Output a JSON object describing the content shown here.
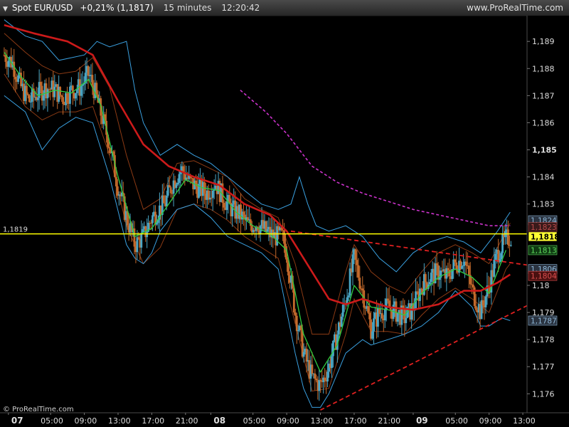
{
  "header": {
    "instrument": "Spot EUR/USD",
    "change": "+0,21% (1,1817)",
    "timeframe": "15 minutes",
    "time": "12:20:42",
    "website": "www.ProRealTime.com"
  },
  "copyright": "© ProRealTime.com",
  "colors": {
    "background": "#000000",
    "up_candle": "#4aa7c6",
    "down_candle": "#c46a2c",
    "ma_green": "#2ecc40",
    "ma_red": "#cc1a1a",
    "bollinger": "#3aa0e0",
    "envelope": "#8b3a14",
    "ma_dashed_magenta": "#cc33cc",
    "trendline_red": "#e02020",
    "price_line": "#ffff00"
  },
  "chart_data": {
    "type": "candlestick",
    "instrument": "Spot EUR/USD",
    "timeframe": "15 minutes",
    "ylim": [
      1.1753,
      1.18995
    ],
    "y_ticks": [
      "1,189",
      "1,188",
      "1,187",
      "1,186",
      "1,185",
      "1,184",
      "1,183",
      "1,18",
      "1,179",
      "1,178",
      "1,177",
      "1,176"
    ],
    "y_tick_values": [
      1.189,
      1.188,
      1.187,
      1.186,
      1.185,
      1.184,
      1.183,
      1.18,
      1.179,
      1.178,
      1.177,
      1.176
    ],
    "x_labels": [
      {
        "label": "07",
        "x": 0,
        "bold": true
      },
      {
        "label": "05:00",
        "x": 5,
        "bold": false
      },
      {
        "label": "09:00",
        "x": 9,
        "bold": false
      },
      {
        "label": "13:00",
        "x": 13,
        "bold": false
      },
      {
        "label": "17:00",
        "x": 17,
        "bold": false
      },
      {
        "label": "21:00",
        "x": 21,
        "bold": false
      },
      {
        "label": "08",
        "x": 24,
        "bold": true
      },
      {
        "label": "05:00",
        "x": 29,
        "bold": false
      },
      {
        "label": "09:00",
        "x": 33,
        "bold": false
      },
      {
        "label": "13:00",
        "x": 37,
        "bold": false
      },
      {
        "label": "17:00",
        "x": 41,
        "bold": false
      },
      {
        "label": "21:00",
        "x": 45,
        "bold": false
      },
      {
        "label": "09",
        "x": 48,
        "bold": true
      },
      {
        "label": "05:00",
        "x": 53,
        "bold": false
      },
      {
        "label": "09:00",
        "x": 57,
        "bold": false
      },
      {
        "label": "13:00",
        "x": 61,
        "bold": false
      }
    ],
    "x_range": [
      -1,
      61.5
    ],
    "price_line": {
      "value": 1.1819,
      "label": "1,1819"
    },
    "right_price_labels": [
      {
        "text": "1,1824",
        "value": 1.1824,
        "bg": "#2a3340",
        "color": "#8fb8d8"
      },
      {
        "text": "1,1823",
        "value": 1.18215,
        "bg": "#3a1a1a",
        "color": "#b84a4a"
      },
      {
        "text": "1,1818",
        "value": 1.1818,
        "bg": "#ffff33",
        "color": "#000000"
      },
      {
        "text": "1,1813",
        "value": 1.1813,
        "bg": "#0f3a12",
        "color": "#5fdc5f"
      },
      {
        "text": "1,1806",
        "value": 1.1806,
        "bg": "#2a3340",
        "color": "#8fb8d8"
      },
      {
        "text": "1,1804",
        "value": 1.18035,
        "bg": "#4a1010",
        "color": "#e05050"
      },
      {
        "text": "1,1787",
        "value": 1.1787,
        "bg": "#2a3340",
        "color": "#8fb8d8"
      }
    ],
    "close_path": [
      [
        -0.5,
        1.1885
      ],
      [
        0.5,
        1.1882
      ],
      [
        1.5,
        1.1873
      ],
      [
        2.5,
        1.1868
      ],
      [
        3.5,
        1.1871
      ],
      [
        4.5,
        1.1873
      ],
      [
        5.5,
        1.1872
      ],
      [
        6.5,
        1.1869
      ],
      [
        7.5,
        1.1872
      ],
      [
        8.5,
        1.1873
      ],
      [
        9.5,
        1.1878
      ],
      [
        10.0,
        1.1874
      ],
      [
        11.0,
        1.1863
      ],
      [
        12.0,
        1.1852
      ],
      [
        13.0,
        1.1836
      ],
      [
        14.0,
        1.1825
      ],
      [
        15.0,
        1.1815
      ],
      [
        16.0,
        1.1818
      ],
      [
        17.0,
        1.1825
      ],
      [
        18.5,
        1.183
      ],
      [
        19.5,
        1.1838
      ],
      [
        20.5,
        1.1843
      ],
      [
        21.5,
        1.1838
      ],
      [
        22.5,
        1.1836
      ],
      [
        23.5,
        1.1834
      ],
      [
        24.5,
        1.1838
      ],
      [
        25.5,
        1.1832
      ],
      [
        26.5,
        1.1828
      ],
      [
        27.5,
        1.1826
      ],
      [
        28.5,
        1.1822
      ],
      [
        29.5,
        1.1823
      ],
      [
        30.5,
        1.182
      ],
      [
        31.5,
        1.1818
      ],
      [
        32.5,
        1.1818
      ],
      [
        33.0,
        1.1812
      ],
      [
        34.0,
        1.179
      ],
      [
        35.0,
        1.1775
      ],
      [
        36.0,
        1.1766
      ],
      [
        37.0,
        1.1763
      ],
      [
        38.0,
        1.177
      ],
      [
        39.0,
        1.1782
      ],
      [
        40.0,
        1.1795
      ],
      [
        41.0,
        1.181
      ],
      [
        42.0,
        1.1798
      ],
      [
        43.0,
        1.1784
      ],
      [
        44.0,
        1.179
      ],
      [
        45.0,
        1.1792
      ],
      [
        46.0,
        1.179
      ],
      [
        47.0,
        1.1788
      ],
      [
        48.0,
        1.1792
      ],
      [
        49.0,
        1.18
      ],
      [
        50.0,
        1.1803
      ],
      [
        51.0,
        1.1805
      ],
      [
        52.0,
        1.1803
      ],
      [
        53.0,
        1.1808
      ],
      [
        54.0,
        1.181
      ],
      [
        55.0,
        1.1798
      ],
      [
        56.0,
        1.179
      ],
      [
        57.0,
        1.18
      ],
      [
        58.0,
        1.1812
      ],
      [
        59.0,
        1.1817
      ],
      [
        59.6,
        1.1818
      ]
    ],
    "moving_averages": [
      {
        "style": "solid",
        "color": "#2ecc40",
        "width": 1.3,
        "points": [
          [
            -0.5,
            1.1886
          ],
          [
            1.5,
            1.1877
          ],
          [
            3.5,
            1.187
          ],
          [
            5.5,
            1.1872
          ],
          [
            7.5,
            1.1871
          ],
          [
            9.5,
            1.1876
          ],
          [
            11.0,
            1.1866
          ],
          [
            13.0,
            1.184
          ],
          [
            15.0,
            1.1818
          ],
          [
            17.0,
            1.1821
          ],
          [
            19.0,
            1.183
          ],
          [
            21.0,
            1.1839
          ],
          [
            23.0,
            1.1836
          ],
          [
            25.0,
            1.1835
          ],
          [
            27.0,
            1.1827
          ],
          [
            29.0,
            1.1822
          ],
          [
            31.0,
            1.1819
          ],
          [
            33.0,
            1.1813
          ],
          [
            35.0,
            1.1782
          ],
          [
            37.0,
            1.1768
          ],
          [
            39.0,
            1.1778
          ],
          [
            41.0,
            1.18
          ],
          [
            43.0,
            1.1792
          ],
          [
            45.0,
            1.1791
          ],
          [
            47.0,
            1.1789
          ],
          [
            49.0,
            1.1797
          ],
          [
            51.0,
            1.1803
          ],
          [
            53.0,
            1.1806
          ],
          [
            55.0,
            1.1803
          ],
          [
            57.0,
            1.1797
          ],
          [
            59.0,
            1.1813
          ]
        ]
      },
      {
        "style": "solid",
        "color": "#cc1a1a",
        "width": 2.6,
        "points": [
          [
            -0.5,
            1.1896
          ],
          [
            3.0,
            1.1893
          ],
          [
            7.0,
            1.189
          ],
          [
            10.0,
            1.1885
          ],
          [
            13.0,
            1.1868
          ],
          [
            16.0,
            1.1852
          ],
          [
            19.0,
            1.1844
          ],
          [
            22.0,
            1.184
          ],
          [
            25.0,
            1.1837
          ],
          [
            28.0,
            1.183
          ],
          [
            31.0,
            1.1826
          ],
          [
            33.0,
            1.182
          ],
          [
            36.0,
            1.1805
          ],
          [
            38.0,
            1.1795
          ],
          [
            40.0,
            1.1793
          ],
          [
            42.0,
            1.1795
          ],
          [
            45.0,
            1.1792
          ],
          [
            48.0,
            1.1791
          ],
          [
            51.0,
            1.1793
          ],
          [
            54.0,
            1.1798
          ],
          [
            56.0,
            1.1798
          ],
          [
            58.0,
            1.1801
          ],
          [
            59.5,
            1.1804
          ]
        ]
      },
      {
        "style": "dashed",
        "color": "#cc33cc",
        "width": 1.6,
        "points": [
          [
            27.5,
            1.1872
          ],
          [
            30.5,
            1.1864
          ],
          [
            33.0,
            1.1856
          ],
          [
            36.0,
            1.1844
          ],
          [
            39.0,
            1.1838
          ],
          [
            42.0,
            1.1834
          ],
          [
            45.0,
            1.1831
          ],
          [
            48.0,
            1.1828
          ],
          [
            51.0,
            1.1826
          ],
          [
            54.0,
            1.1824
          ],
          [
            57.0,
            1.1822
          ],
          [
            59.5,
            1.1822
          ]
        ]
      }
    ],
    "bands": [
      {
        "color": "#3aa0e0",
        "width": 1,
        "points": [
          [
            -0.5,
            1.1898
          ],
          [
            2.0,
            1.1892
          ],
          [
            4.0,
            1.189
          ],
          [
            6.0,
            1.1883
          ],
          [
            9.0,
            1.1885
          ],
          [
            10.5,
            1.189
          ],
          [
            12.0,
            1.1888
          ],
          [
            14.0,
            1.189
          ],
          [
            15.0,
            1.1872
          ],
          [
            16.0,
            1.186
          ],
          [
            18.0,
            1.1848
          ],
          [
            20.0,
            1.1852
          ],
          [
            22.0,
            1.1848
          ],
          [
            24.0,
            1.1845
          ],
          [
            26.0,
            1.184
          ],
          [
            28.0,
            1.1835
          ],
          [
            30.0,
            1.183
          ],
          [
            32.0,
            1.1828
          ],
          [
            33.5,
            1.183
          ],
          [
            34.5,
            1.184
          ],
          [
            35.5,
            1.183
          ],
          [
            36.5,
            1.1822
          ],
          [
            38.0,
            1.182
          ],
          [
            40.0,
            1.1822
          ],
          [
            42.0,
            1.1818
          ],
          [
            44.0,
            1.181
          ],
          [
            46.0,
            1.1805
          ],
          [
            48.0,
            1.1812
          ],
          [
            50.0,
            1.1816
          ],
          [
            52.0,
            1.1818
          ],
          [
            54.0,
            1.1816
          ],
          [
            56.0,
            1.1812
          ],
          [
            58.0,
            1.182
          ],
          [
            59.5,
            1.1827
          ]
        ]
      },
      {
        "color": "#3aa0e0",
        "width": 1,
        "points": [
          [
            -0.5,
            1.187
          ],
          [
            2.0,
            1.1864
          ],
          [
            4.0,
            1.185
          ],
          [
            6.0,
            1.1858
          ],
          [
            8.0,
            1.1862
          ],
          [
            10.0,
            1.186
          ],
          [
            12.0,
            1.184
          ],
          [
            14.0,
            1.1815
          ],
          [
            15.0,
            1.181
          ],
          [
            16.0,
            1.1808
          ],
          [
            17.0,
            1.1812
          ],
          [
            18.0,
            1.182
          ],
          [
            20.0,
            1.1828
          ],
          [
            22.0,
            1.183
          ],
          [
            24.0,
            1.1825
          ],
          [
            26.0,
            1.1818
          ],
          [
            28.0,
            1.1815
          ],
          [
            30.0,
            1.1812
          ],
          [
            32.0,
            1.1806
          ],
          [
            34.0,
            1.1775
          ],
          [
            35.0,
            1.1762
          ],
          [
            36.0,
            1.1755
          ],
          [
            37.0,
            1.1755
          ],
          [
            38.0,
            1.176
          ],
          [
            40.0,
            1.1775
          ],
          [
            42.0,
            1.178
          ],
          [
            43.0,
            1.1778
          ],
          [
            45.0,
            1.178
          ],
          [
            47.0,
            1.1782
          ],
          [
            49.0,
            1.1785
          ],
          [
            51.0,
            1.179
          ],
          [
            53.0,
            1.1798
          ],
          [
            55.0,
            1.1792
          ],
          [
            56.0,
            1.1785
          ],
          [
            57.0,
            1.1785
          ],
          [
            58.5,
            1.1788
          ],
          [
            59.5,
            1.1787
          ]
        ]
      }
    ],
    "envelopes": [
      {
        "color": "#8b3a14",
        "width": 1,
        "points": [
          [
            -0.5,
            1.1893
          ],
          [
            2.0,
            1.1886
          ],
          [
            4.0,
            1.1881
          ],
          [
            6.0,
            1.1878
          ],
          [
            8.0,
            1.1879
          ],
          [
            10.0,
            1.1884
          ],
          [
            12.0,
            1.1873
          ],
          [
            14.0,
            1.1848
          ],
          [
            16.0,
            1.1828
          ],
          [
            18.0,
            1.1832
          ],
          [
            20.0,
            1.1845
          ],
          [
            22.0,
            1.1846
          ],
          [
            24.0,
            1.1843
          ],
          [
            26.0,
            1.184
          ],
          [
            28.0,
            1.1832
          ],
          [
            30.0,
            1.1828
          ],
          [
            32.0,
            1.1825
          ],
          [
            34.0,
            1.1808
          ],
          [
            36.0,
            1.1782
          ],
          [
            38.0,
            1.1782
          ],
          [
            40.0,
            1.1805
          ],
          [
            41.0,
            1.1815
          ],
          [
            43.0,
            1.1805
          ],
          [
            45.0,
            1.18
          ],
          [
            47.0,
            1.1797
          ],
          [
            49.0,
            1.1805
          ],
          [
            51.0,
            1.1812
          ],
          [
            53.0,
            1.1815
          ],
          [
            55.0,
            1.1812
          ],
          [
            57.0,
            1.1808
          ],
          [
            59.0,
            1.182
          ],
          [
            59.5,
            1.1823
          ]
        ]
      },
      {
        "color": "#8b3a14",
        "width": 1,
        "points": [
          [
            -0.5,
            1.1878
          ],
          [
            2.0,
            1.1866
          ],
          [
            4.0,
            1.1861
          ],
          [
            6.0,
            1.1864
          ],
          [
            8.0,
            1.1864
          ],
          [
            10.0,
            1.1866
          ],
          [
            12.0,
            1.1848
          ],
          [
            14.0,
            1.1822
          ],
          [
            16.0,
            1.1808
          ],
          [
            18.0,
            1.1814
          ],
          [
            20.0,
            1.1828
          ],
          [
            22.0,
            1.183
          ],
          [
            24.0,
            1.1828
          ],
          [
            26.0,
            1.1824
          ],
          [
            28.0,
            1.1818
          ],
          [
            30.0,
            1.1814
          ],
          [
            32.0,
            1.181
          ],
          [
            34.0,
            1.1786
          ],
          [
            36.0,
            1.1761
          ],
          [
            38.0,
            1.1762
          ],
          [
            40.0,
            1.1782
          ],
          [
            41.0,
            1.1795
          ],
          [
            43.0,
            1.1783
          ],
          [
            45.0,
            1.1783
          ],
          [
            47.0,
            1.1782
          ],
          [
            49.0,
            1.1789
          ],
          [
            51.0,
            1.1795
          ],
          [
            53.0,
            1.1799
          ],
          [
            55.0,
            1.1795
          ],
          [
            57.0,
            1.179
          ],
          [
            59.0,
            1.1806
          ],
          [
            59.5,
            1.1808
          ]
        ]
      }
    ],
    "trendlines": [
      {
        "style": "dashed",
        "color": "#e02020",
        "width": 1.8,
        "points": [
          [
            33.5,
            1.182
          ],
          [
            61.5,
            1.18075
          ]
        ]
      },
      {
        "style": "dashed",
        "color": "#e02020",
        "width": 1.8,
        "points": [
          [
            37.0,
            1.1754
          ],
          [
            61.5,
            1.17925
          ]
        ]
      }
    ]
  }
}
